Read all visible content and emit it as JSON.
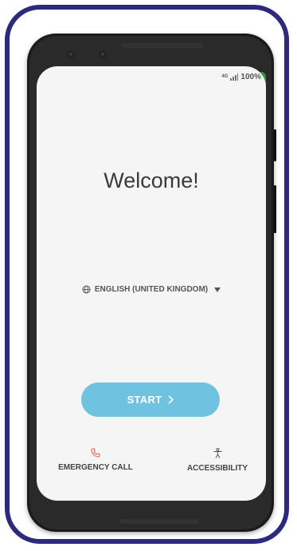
{
  "status_bar": {
    "network": "4G",
    "battery": "100%"
  },
  "setup": {
    "title": "Welcome!",
    "language": "ENGLISH (UNITED KINGDOM)",
    "start_label": "START",
    "emergency_label": "EMERGENCY CALL",
    "accessibility_label": "ACCESSIBILITY"
  },
  "icons": {
    "language": "globe-icon",
    "dropdown": "triangle-down-icon",
    "start": "chevron-right-icon",
    "emergency": "phone-icon",
    "accessibility": "accessibility-icon"
  },
  "colors": {
    "frame_border": "#2d2a7e",
    "start_button": "#6fc3e1",
    "emergency_icon": "#e05a4a",
    "screen_bg": "#f5f5f6"
  }
}
